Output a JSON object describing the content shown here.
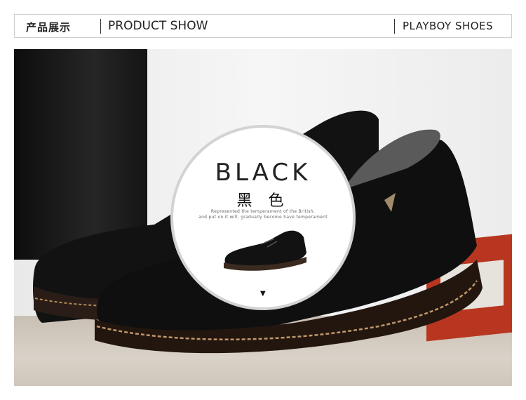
{
  "header": {
    "cn_title": "产品展示",
    "en_title": "PRODUCT SHOW",
    "brand": "PLAYBOY SHOES"
  },
  "badge": {
    "color_en": "BLACK",
    "color_cn": "黑 色",
    "line1": "Represented the temperament of the British,",
    "line2": "and put on it will, gradually become have temperament",
    "arrow": "▼"
  },
  "colors": {
    "frame_red": "#b8361f",
    "shoe_black": "#111111"
  },
  "icons": {
    "arrow": "down-triangle-icon"
  }
}
